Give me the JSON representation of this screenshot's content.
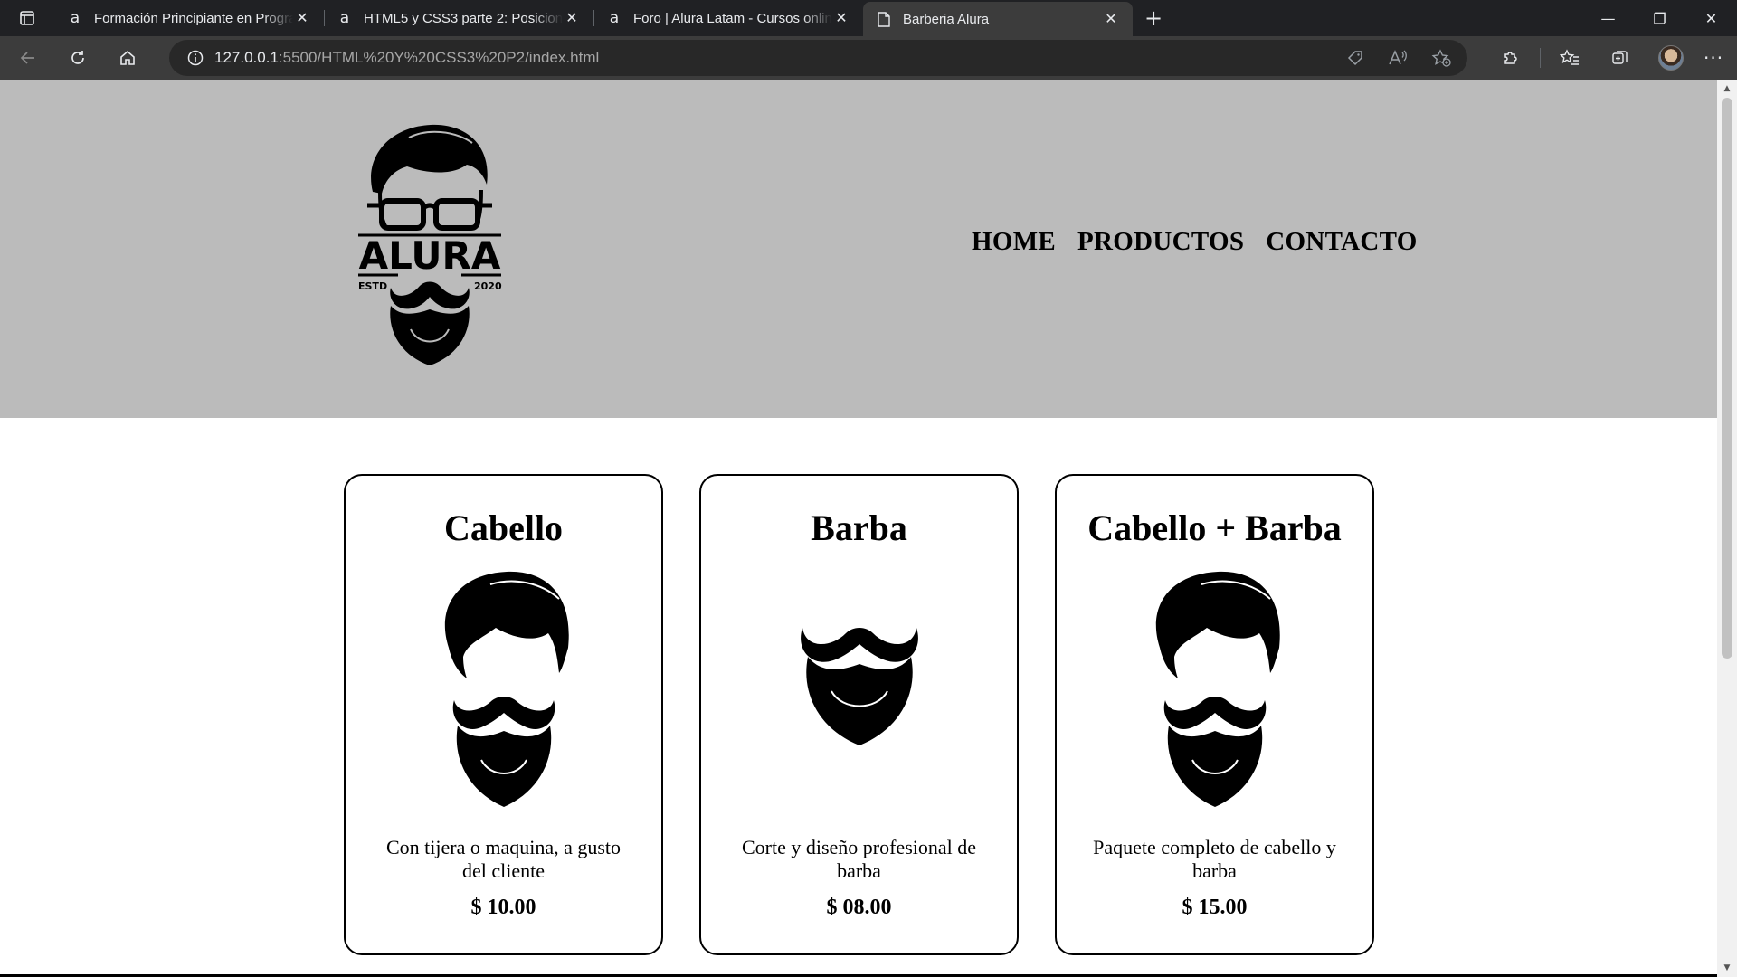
{
  "browser": {
    "tabs": [
      {
        "title": "Formación Principiante en Progra",
        "favicon": "alura-icon",
        "active": false
      },
      {
        "title": "HTML5 y CSS3 parte 2: Posiciona",
        "favicon": "alura-icon",
        "active": false
      },
      {
        "title": "Foro | Alura Latam - Cursos onlin",
        "favicon": "alura-icon",
        "active": false
      },
      {
        "title": "Barberia Alura",
        "favicon": "page-icon",
        "active": true
      }
    ],
    "favicon_glyph": "a",
    "close_glyph": "✕",
    "new_tab_glyph": "+",
    "address": {
      "host": "127.0.0.1",
      "path": ":5500/HTML%20Y%20CSS3%20P2/index.html"
    },
    "window_controls": {
      "minimize": "—",
      "restore": "❐",
      "close": "✕"
    },
    "menu_glyph": "···"
  },
  "site": {
    "logo": {
      "brand": "ALURA",
      "left_text": "ESTD",
      "right_text": "2020"
    },
    "nav": [
      "HOME",
      "PRODUCTOS",
      "CONTACTO"
    ],
    "cards": [
      {
        "title": "Cabello",
        "description": "Con tijera o maquina, a gusto del cliente",
        "price": "$ 10.00",
        "image": "hair-and-beard-icon"
      },
      {
        "title": "Barba",
        "description": "Corte y diseño profesional de barba",
        "price": "$ 08.00",
        "image": "beard-icon"
      },
      {
        "title": "Cabello + Barba",
        "description": "Paquete completo de cabello y barba",
        "price": "$ 15.00",
        "image": "hair-and-beard-icon"
      }
    ]
  },
  "colors": {
    "browser_frame": "#202124",
    "toolbar": "#3c3c3c",
    "site_header": "#bbbbbb",
    "page_background": "#ffffff",
    "card_border": "#000000"
  }
}
